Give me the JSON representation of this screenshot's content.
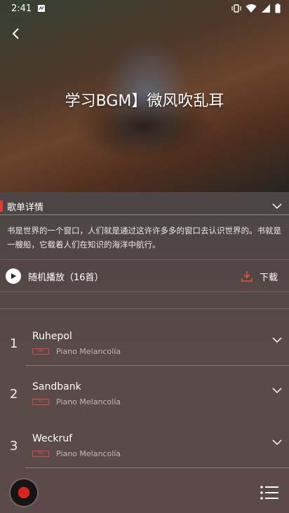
{
  "status_bar": {
    "time": "2:41",
    "icons": [
      "notification-icon",
      "vibrate-icon",
      "wifi-icon",
      "signal-icon",
      "battery-icon"
    ]
  },
  "header": {
    "title": "学习BGM】微风吹乱耳"
  },
  "detail": {
    "heading": "歌单详情",
    "description": "书是世界的一个窗口，人们就是通过这许许多多的窗口去认识世界的。书就是一艘船，它载着人们在知识的海洋中航行。"
  },
  "actions": {
    "shuffle_play": "随机播放（16首）",
    "download": "下载"
  },
  "tracks": [
    {
      "index": "1",
      "title": "Ruhepol",
      "artist": "Piano Melancolía",
      "badge": "SQ"
    },
    {
      "index": "2",
      "title": "Sandbank",
      "artist": "Piano Melancolía",
      "badge": "SQ"
    },
    {
      "index": "3",
      "title": "Weckruf",
      "artist": "Piano Melancolía",
      "badge": "SQ"
    }
  ],
  "colors": {
    "accent": "#e53935",
    "download": "#e0524a"
  }
}
